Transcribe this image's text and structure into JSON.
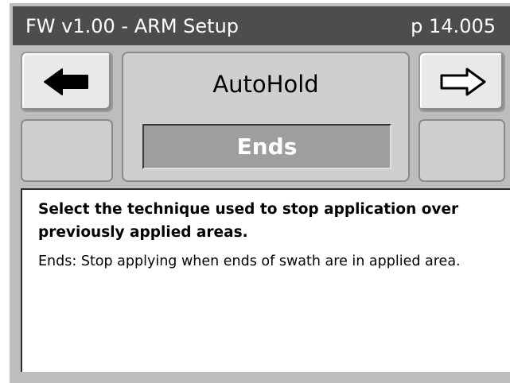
{
  "header": {
    "title": "FW v1.00 - ARM Setup",
    "page": "p 14.005"
  },
  "navigation": {
    "prev_icon": "arrow-left-filled-icon",
    "next_icon": "arrow-right-outline-icon"
  },
  "setting": {
    "name": "AutoHold",
    "value": "Ends"
  },
  "help": {
    "heading": "Select the technique used to stop application over previously applied areas.",
    "detail": "Ends: Stop applying when ends of swath are in applied area."
  },
  "colors": {
    "titlebar_bg": "#4d4d4d",
    "frame_bg": "#bdbdbd",
    "value_bg": "#9e9e9e"
  }
}
